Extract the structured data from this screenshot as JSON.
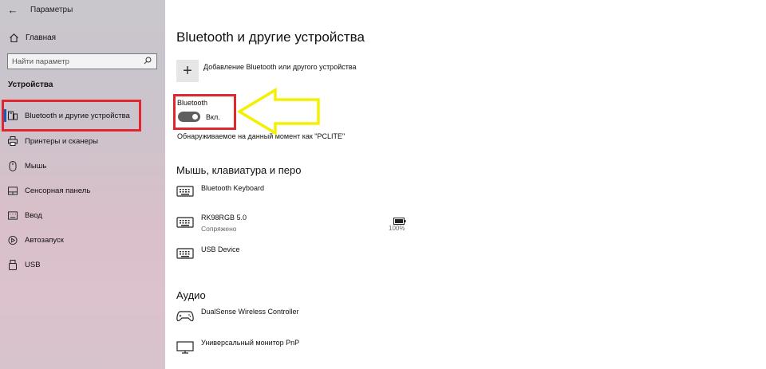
{
  "window": {
    "title": "Параметры"
  },
  "sidebar": {
    "home_label": "Главная",
    "search_placeholder": "Найти параметр",
    "section_title": "Устройства",
    "items": [
      {
        "label": "Bluetooth и другие устройства",
        "icon": "bluetooth-devices-icon",
        "active": true
      },
      {
        "label": "Принтеры и сканеры",
        "icon": "printer-icon"
      },
      {
        "label": "Мышь",
        "icon": "mouse-icon"
      },
      {
        "label": "Сенсорная панель",
        "icon": "touchpad-icon"
      },
      {
        "label": "Ввод",
        "icon": "keyboard-icon"
      },
      {
        "label": "Автозапуск",
        "icon": "autoplay-icon"
      },
      {
        "label": "USB",
        "icon": "usb-icon"
      }
    ]
  },
  "main": {
    "title": "Bluetooth и другие устройства",
    "add_device_label": "Добавление Bluetooth или другого устройства",
    "bluetooth": {
      "label": "Bluetooth",
      "toggle_state": "Вкл.",
      "discoverable_text": "Обнаруживаемое на данный момент как \"PCLITE\""
    },
    "sections": {
      "mouse_keyboard": {
        "title": "Мышь, клавиатура и перо",
        "devices": [
          {
            "name": "Bluetooth Keyboard",
            "status": "",
            "icon": "keyboard-icon"
          },
          {
            "name": "RK98RGB 5.0",
            "status": "Сопряжено",
            "battery": "100%",
            "icon": "keyboard-icon"
          },
          {
            "name": "USB Device",
            "status": "",
            "icon": "keyboard-icon"
          }
        ]
      },
      "audio": {
        "title": "Аудио",
        "devices": [
          {
            "name": "DualSense Wireless Controller",
            "icon": "gamepad-icon"
          },
          {
            "name": "Универсальный монитор PnP",
            "icon": "monitor-icon"
          }
        ]
      }
    }
  },
  "colors": {
    "highlight_frame": "#e0262f",
    "annotation_arrow": "#f5f000",
    "accent": "#0a5fc4",
    "toggle_on": "#5f5f5f"
  }
}
